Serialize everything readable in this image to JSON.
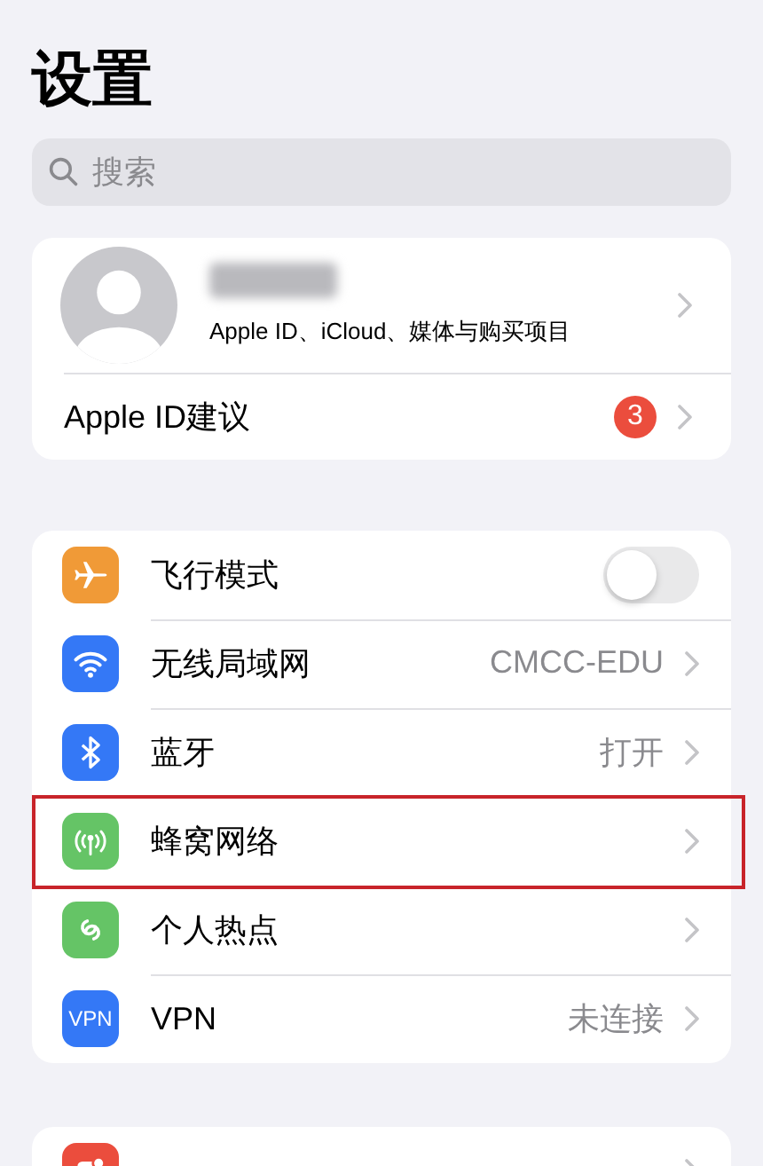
{
  "title": "设置",
  "search": {
    "placeholder": "搜索"
  },
  "account": {
    "subtitle": "Apple ID、iCloud、媒体与购买项目",
    "suggestions": {
      "label": "Apple ID建议",
      "badge": "3"
    }
  },
  "network_settings": [
    {
      "kind": "airplane",
      "color": "#f09a37",
      "label": "飞行模式",
      "on": false,
      "highlighted": false
    },
    {
      "kind": "wifi",
      "color": "#3478f6",
      "label": "无线局域网",
      "value": "CMCC-EDU",
      "highlighted": false
    },
    {
      "kind": "bluetooth",
      "color": "#3478f6",
      "label": "蓝牙",
      "value": "打开",
      "highlighted": false
    },
    {
      "kind": "cellular",
      "color": "#65c466",
      "label": "蜂窝网络",
      "highlighted": true
    },
    {
      "kind": "hotspot",
      "color": "#65c466",
      "label": "个人热点",
      "highlighted": false
    },
    {
      "kind": "vpn",
      "color": "#3478f6",
      "icon_text": "VPN",
      "label": "VPN",
      "value": "未连接",
      "highlighted": false
    }
  ],
  "more_settings": [
    {
      "kind": "notifications",
      "color": "#eb4d3d"
    }
  ]
}
